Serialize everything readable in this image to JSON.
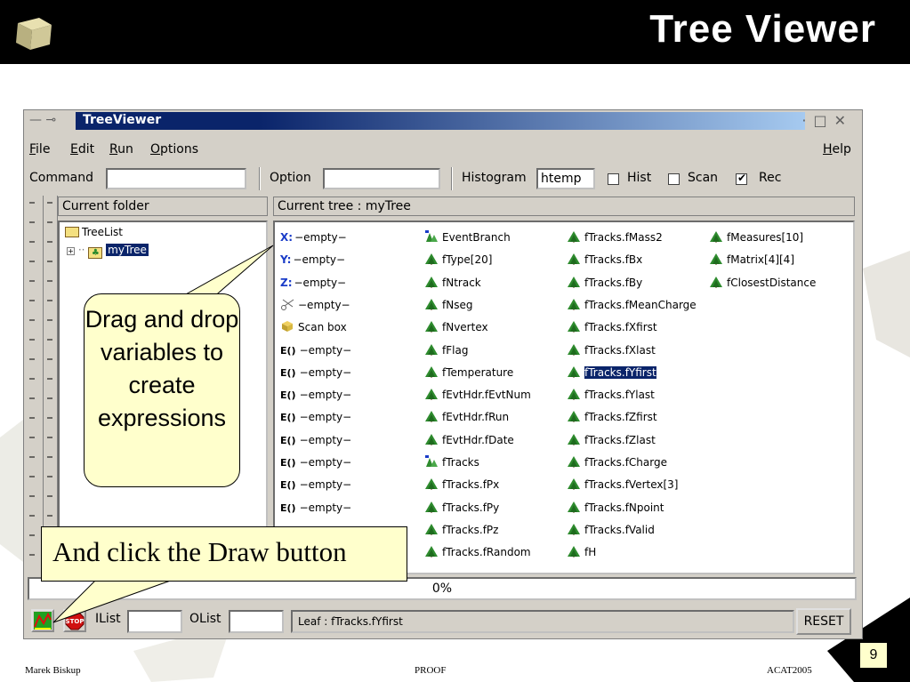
{
  "slide": {
    "title": "Tree Viewer",
    "footer_left": "Marek Biskup",
    "footer_center": "PROOF",
    "footer_right": "ACAT2005",
    "page_number": "9"
  },
  "window": {
    "title": "TreeViewer",
    "menu": [
      {
        "label": "File",
        "u": "F",
        "rest": "ile"
      },
      {
        "label": "Edit",
        "u": "E",
        "rest": "dit"
      },
      {
        "label": "Run",
        "u": "R",
        "rest": "un"
      },
      {
        "label": "Options",
        "u": "O",
        "rest": "ptions"
      },
      {
        "label": "Help",
        "u": "H",
        "rest": "elp"
      }
    ],
    "toolbar": {
      "command_label": "Command",
      "command_value": "",
      "option_label": "Option",
      "option_value": "",
      "histogram_label": "Histogram",
      "histogram_value": "htemp",
      "hist_label": "Hist",
      "hist_checked": false,
      "scan_label": "Scan",
      "scan_checked": false,
      "rec_label": "Rec",
      "rec_checked": true
    },
    "folder_header": "Current folder",
    "folder_tree": [
      {
        "label": "TreeList",
        "icon": "folder-icon",
        "selected": false
      },
      {
        "label": "myTree",
        "icon": "tree-icon",
        "selected": true
      }
    ],
    "tree_header": "Current tree : myTree",
    "columns": [
      [
        {
          "prefix": "X:",
          "label": "−empty−",
          "icon": "x-axis-icon"
        },
        {
          "prefix": "Y:",
          "label": "−empty−",
          "icon": "y-axis-icon"
        },
        {
          "prefix": "Z:",
          "label": "−empty−",
          "icon": "z-axis-icon"
        },
        {
          "prefix": "",
          "label": "−empty−",
          "icon": "scissors-icon"
        },
        {
          "prefix": "",
          "label": "Scan box",
          "icon": "scan-box-icon"
        },
        {
          "prefix": "E()",
          "label": "−empty−",
          "icon": "expression-icon"
        },
        {
          "prefix": "E()",
          "label": "−empty−",
          "icon": "expression-icon"
        },
        {
          "prefix": "E()",
          "label": "−empty−",
          "icon": "expression-icon"
        },
        {
          "prefix": "E()",
          "label": "−empty−",
          "icon": "expression-icon"
        },
        {
          "prefix": "E()",
          "label": "−empty−",
          "icon": "expression-icon"
        },
        {
          "prefix": "E()",
          "label": "−empty−",
          "icon": "expression-icon"
        },
        {
          "prefix": "E()",
          "label": "−empty−",
          "icon": "expression-icon"
        },
        {
          "prefix": "E()",
          "label": "−empty−",
          "icon": "expression-icon"
        }
      ],
      [
        {
          "label": "EventBranch",
          "icon": "branch-icon"
        },
        {
          "label": "fType[20]",
          "icon": "leaf-icon"
        },
        {
          "label": "fNtrack",
          "icon": "leaf-icon"
        },
        {
          "label": "fNseg",
          "icon": "leaf-icon"
        },
        {
          "label": "fNvertex",
          "icon": "leaf-icon"
        },
        {
          "label": "fFlag",
          "icon": "leaf-icon"
        },
        {
          "label": "fTemperature",
          "icon": "leaf-icon"
        },
        {
          "label": "fEvtHdr.fEvtNum",
          "icon": "leaf-icon"
        },
        {
          "label": "fEvtHdr.fRun",
          "icon": "leaf-icon"
        },
        {
          "label": "fEvtHdr.fDate",
          "icon": "leaf-icon"
        },
        {
          "label": "fTracks",
          "icon": "branch-icon"
        },
        {
          "label": "fTracks.fPx",
          "icon": "leaf-icon"
        },
        {
          "label": "fTracks.fPy",
          "icon": "leaf-icon"
        },
        {
          "label": "fTracks.fPz",
          "icon": "leaf-icon"
        },
        {
          "label": "fTracks.fRandom",
          "icon": "leaf-icon"
        }
      ],
      [
        {
          "label": "fTracks.fMass2",
          "icon": "leaf-icon"
        },
        {
          "label": "fTracks.fBx",
          "icon": "leaf-icon"
        },
        {
          "label": "fTracks.fBy",
          "icon": "leaf-icon"
        },
        {
          "label": "fTracks.fMeanCharge",
          "icon": "leaf-icon"
        },
        {
          "label": "fTracks.fXfirst",
          "icon": "leaf-icon"
        },
        {
          "label": "fTracks.fXlast",
          "icon": "leaf-icon"
        },
        {
          "label": "fTracks.fYfirst",
          "icon": "leaf-icon",
          "selected": true
        },
        {
          "label": "fTracks.fYlast",
          "icon": "leaf-icon"
        },
        {
          "label": "fTracks.fZfirst",
          "icon": "leaf-icon"
        },
        {
          "label": "fTracks.fZlast",
          "icon": "leaf-icon"
        },
        {
          "label": "fTracks.fCharge",
          "icon": "leaf-icon"
        },
        {
          "label": "fTracks.fVertex[3]",
          "icon": "leaf-icon"
        },
        {
          "label": "fTracks.fNpoint",
          "icon": "leaf-icon"
        },
        {
          "label": "fTracks.fValid",
          "icon": "leaf-icon"
        },
        {
          "label": "fH",
          "icon": "leaf-icon"
        }
      ],
      [
        {
          "label": "fMeasures[10]",
          "icon": "leaf-icon"
        },
        {
          "label": "fMatrix[4][4]",
          "icon": "leaf-icon"
        },
        {
          "label": "fClosestDistance",
          "icon": "leaf-icon"
        }
      ]
    ],
    "progress_text": "0%",
    "status": {
      "ilist_label": "IList",
      "ilist_value": "",
      "olist_label": "OList",
      "olist_value": "",
      "message": "Leaf : fTracks.fYfirst",
      "reset_label": "RESET"
    }
  },
  "callouts": {
    "drag_drop": "Drag and drop variables to create expressions",
    "draw_button": "And click the Draw button"
  },
  "colors": {
    "selection": "#0a246a",
    "callout_fill": "#ffffcc",
    "window_bg": "#d4d0c8",
    "leaf_green": "#2e8b2e"
  }
}
